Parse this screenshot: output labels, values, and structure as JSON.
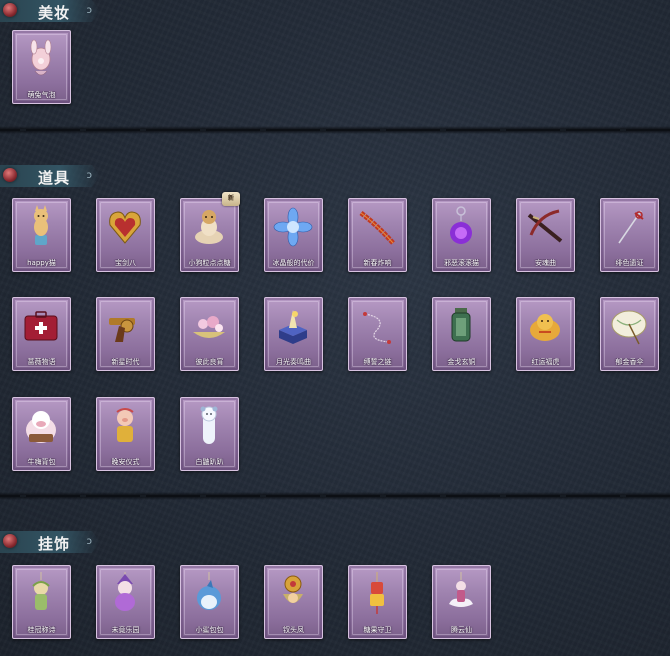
{
  "sections": [
    {
      "title": "美妆",
      "items": [
        {
          "label": "萌兔气泡",
          "icon": "bunny-bubble-icon"
        }
      ]
    },
    {
      "title": "道具",
      "items": [
        {
          "label": "happy猫",
          "icon": "happy-cat-icon"
        },
        {
          "label": "宝剑八",
          "icon": "heart-locket-icon"
        },
        {
          "label": "小狗粒点点糖",
          "icon": "puppy-candy-icon"
        },
        {
          "label": "冰晶般的代价",
          "icon": "ice-crystal-flower-icon"
        },
        {
          "label": "新春炸响",
          "icon": "firecracker-string-icon"
        },
        {
          "label": "邪恶滚滚猫",
          "icon": "purple-orb-icon"
        },
        {
          "label": "安魂曲",
          "icon": "crossbow-icon"
        },
        {
          "label": "绯色遗证",
          "icon": "rapier-icon"
        },
        {
          "label": "蔷薇物语",
          "icon": "first-aid-case-icon"
        },
        {
          "label": "新星时代",
          "icon": "revolver-icon"
        },
        {
          "label": "彼此良宵",
          "icon": "flower-boat-icon"
        },
        {
          "label": "月光奏鸣曲",
          "icon": "music-box-icon"
        },
        {
          "label": "缚誓之链",
          "icon": "chain-icon"
        },
        {
          "label": "金戈玄铜",
          "icon": "green-lantern-icon"
        },
        {
          "label": "红运福虎",
          "icon": "golden-tiger-icon"
        },
        {
          "label": "郁金香伞",
          "icon": "paper-umbrella-icon"
        },
        {
          "label": "牛嗨背包",
          "icon": "cow-backpack-icon"
        },
        {
          "label": "晚安仪式",
          "icon": "pig-doll-icon"
        },
        {
          "label": "白鼬趴趴",
          "icon": "ferret-plush-icon"
        }
      ]
    },
    {
      "title": "挂饰",
      "items": [
        {
          "label": "桂冠称诗",
          "icon": "laurel-doll-charm-icon"
        },
        {
          "label": "未竟乐园",
          "icon": "clown-doll-charm-icon"
        },
        {
          "label": "小鲨包包",
          "icon": "shark-charm-icon"
        },
        {
          "label": "钗头凤",
          "icon": "phoenix-hairpin-charm-icon"
        },
        {
          "label": "糖果守卫",
          "icon": "candy-guard-charm-icon"
        },
        {
          "label": "腾云仙",
          "icon": "cloud-fairy-charm-icon"
        }
      ]
    }
  ],
  "badge_text": "新",
  "colors": {
    "card_top": "#b79ac5",
    "card_bottom": "#7a5f8a",
    "header_bg": "#335463",
    "background": "#222a36"
  }
}
